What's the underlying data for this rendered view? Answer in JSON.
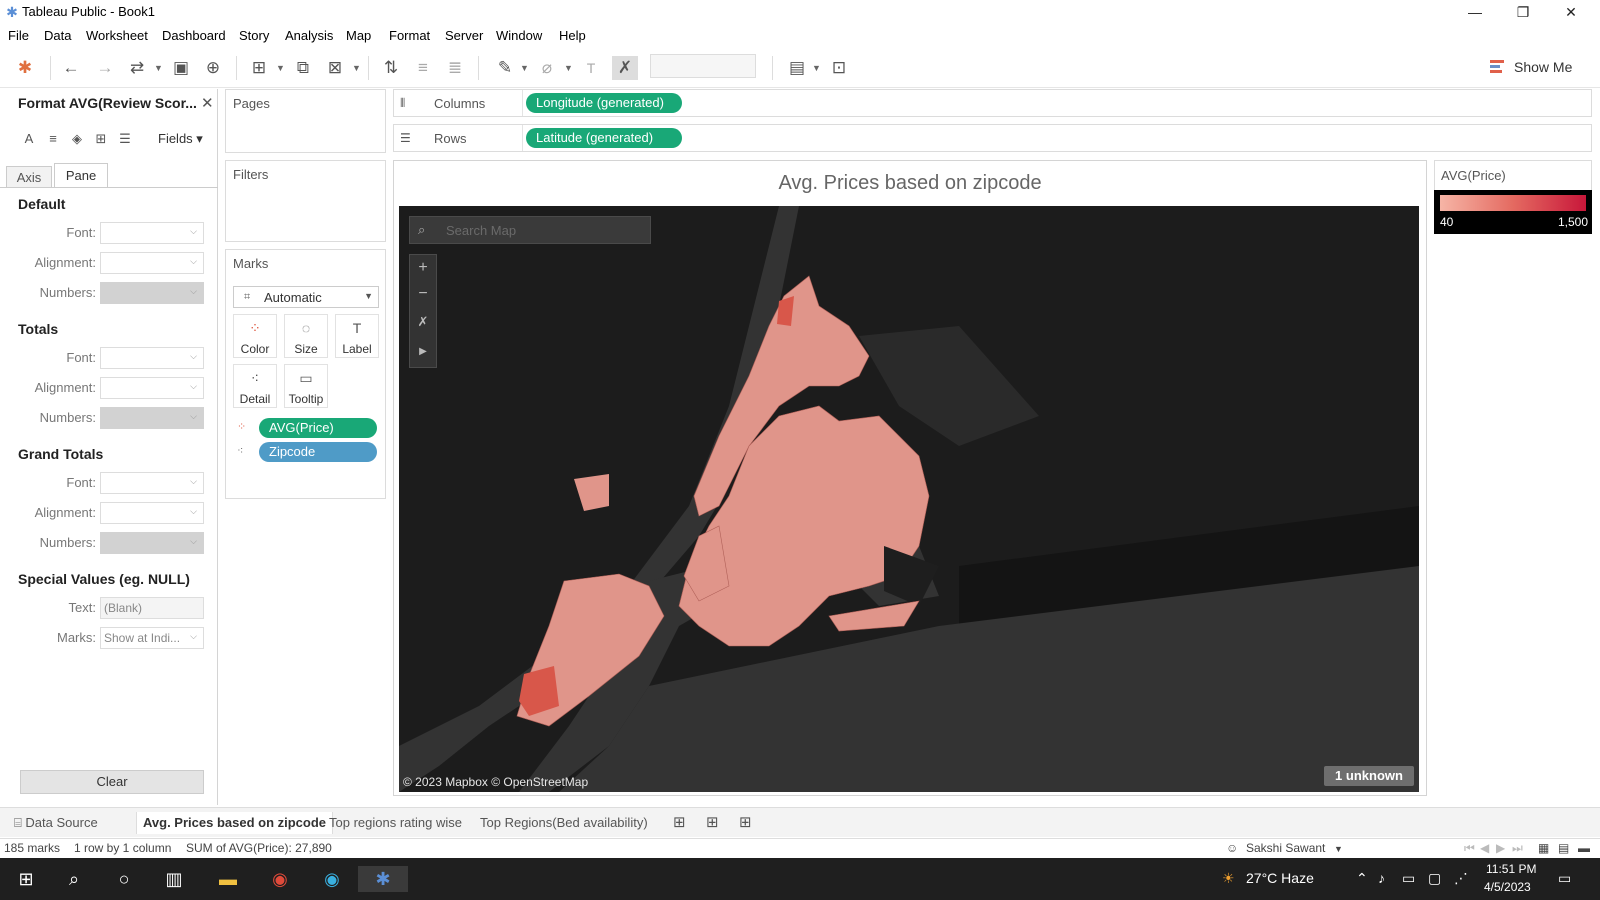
{
  "window": {
    "title": "Tableau Public - Book1",
    "minimize": "—",
    "maximize": "❐",
    "close": "✕"
  },
  "menu": [
    "File",
    "Data",
    "Worksheet",
    "Dashboard",
    "Story",
    "Analysis",
    "Map",
    "Format",
    "Server",
    "Window",
    "Help"
  ],
  "toolbar": {
    "show_me": "Show Me"
  },
  "format_pane": {
    "title": "Format AVG(Review Scor...",
    "fields_label": "Fields ▾",
    "tabs": [
      "Axis",
      "Pane"
    ],
    "sections": {
      "default": "Default",
      "totals": "Totals",
      "grand_totals": "Grand Totals",
      "special_values": "Special Values (eg. NULL)"
    },
    "labels": {
      "font": "Font:",
      "alignment": "Alignment:",
      "numbers": "Numbers:",
      "text": "Text:",
      "marks": "Marks:"
    },
    "values": {
      "text": "(Blank)",
      "marks": "Show at Indi..."
    },
    "clear": "Clear"
  },
  "cards": {
    "pages": "Pages",
    "filters": "Filters",
    "marks": "Marks",
    "mark_type": "Automatic",
    "buttons": [
      "Color",
      "Size",
      "Label",
      "Detail",
      "Tooltip"
    ],
    "pills": [
      "AVG(Price)",
      "Zipcode"
    ]
  },
  "shelves": {
    "columns_label": "Columns",
    "columns_pill": "Longitude (generated)",
    "rows_label": "Rows",
    "rows_pill": "Latitude (generated)"
  },
  "viz": {
    "title": "Avg. Prices based on zipcode",
    "search_placeholder": "Search Map",
    "attribution": "© 2023 Mapbox © OpenStreetMap",
    "unknown": "1 unknown"
  },
  "legend": {
    "title": "AVG(Price)",
    "min": "40",
    "max": "1,500",
    "colors": {
      "low": "#f6b5a6",
      "mid": "#e46a61",
      "high": "#c8173a"
    }
  },
  "sheet_tabs": {
    "data_source": "Data Source",
    "tabs": [
      "Avg. Prices based on zipcode",
      "Top regions rating wise",
      "Top Regions(Bed availability)"
    ],
    "active_index": 0
  },
  "status": {
    "marks": "185 marks",
    "dims": "1 row by 1 column",
    "sum": "SUM of AVG(Price): 27,890",
    "user": "Sakshi Sawant"
  },
  "taskbar": {
    "weather": "27°C  Haze",
    "time": "11:51 PM",
    "date": "4/5/2023"
  },
  "colors": {
    "pill_green": "#19a877",
    "pill_blue": "#4f9bc7",
    "map_bg": "#1e1e1e",
    "region_fill": "#e0958a"
  }
}
